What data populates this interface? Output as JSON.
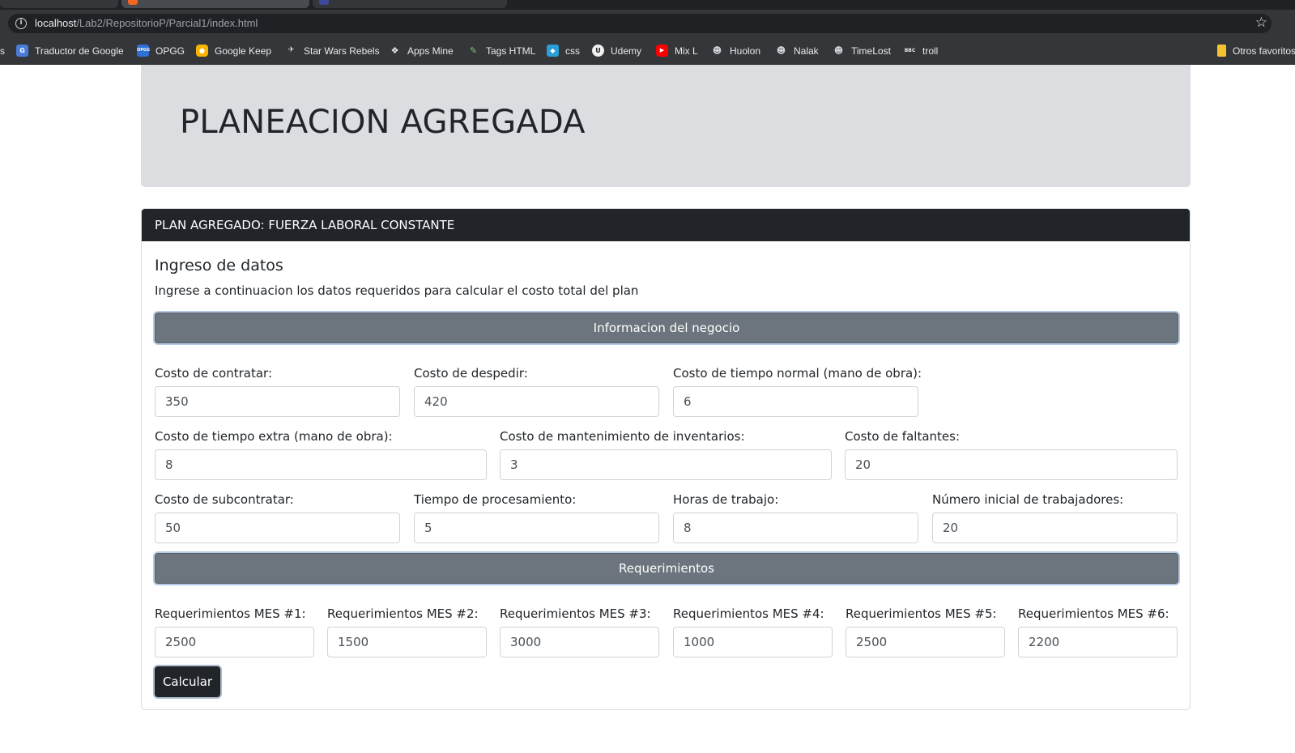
{
  "browser": {
    "url_host": "localhost",
    "url_path": "/Lab2/RepositorioP/Parcial1/index.html",
    "bookmarks": [
      {
        "label": "s"
      },
      {
        "label": "Traductor de Google"
      },
      {
        "label": "OPGG"
      },
      {
        "label": "Google Keep"
      },
      {
        "label": "Star Wars Rebels"
      },
      {
        "label": "Apps Mine"
      },
      {
        "label": "Tags HTML"
      },
      {
        "label": "css"
      },
      {
        "label": "Udemy"
      },
      {
        "label": "Mix L"
      },
      {
        "label": "Huolon"
      },
      {
        "label": "Nalak"
      },
      {
        "label": "TimeLost"
      },
      {
        "label": "troll"
      },
      {
        "label": "Otros favoritos"
      }
    ]
  },
  "jumbotron": {
    "title": "PLANEACION AGREGADA"
  },
  "card": {
    "header": "PLAN AGREGADO: FUERZA LABORAL CONSTANTE",
    "title": "Ingreso de datos",
    "text": "Ingrese a continuacion los datos requeridos para calcular el costo total del plan",
    "section_business": "Informacion del negocio",
    "section_requirements": "Requerimientos",
    "fields": {
      "contratar": {
        "label": "Costo de contratar:",
        "value": "350"
      },
      "despedir": {
        "label": "Costo de despedir:",
        "value": "420"
      },
      "tiempo_normal": {
        "label": "Costo de tiempo normal (mano de obra):",
        "value": "6"
      },
      "tiempo_extra": {
        "label": "Costo de tiempo extra (mano de obra):",
        "value": "8"
      },
      "mantenimiento": {
        "label": "Costo de mantenimiento de inventarios:",
        "value": "3"
      },
      "faltantes": {
        "label": "Costo de faltantes:",
        "value": "20"
      },
      "subcontratar": {
        "label": "Costo de subcontratar:",
        "value": "50"
      },
      "procesamiento": {
        "label": "Tiempo de procesamiento:",
        "value": "5"
      },
      "horas": {
        "label": "Horas de trabajo:",
        "value": "8"
      },
      "trabajadores": {
        "label": "Número inicial de trabajadores:",
        "value": "20"
      }
    },
    "requirements": [
      {
        "label": "Requerimientos MES #1:",
        "value": "2500"
      },
      {
        "label": "Requerimientos MES #2:",
        "value": "1500"
      },
      {
        "label": "Requerimientos MES #3:",
        "value": "3000"
      },
      {
        "label": "Requerimientos MES #4:",
        "value": "1000"
      },
      {
        "label": "Requerimientos MES #5:",
        "value": "2500"
      },
      {
        "label": "Requerimientos MES #6:",
        "value": "2200"
      }
    ],
    "calculate_label": "Calcular"
  },
  "colors": {
    "header_dark": "#212529",
    "section_gray": "#6c757d",
    "jumbotron_bg": "#dcdde0"
  }
}
